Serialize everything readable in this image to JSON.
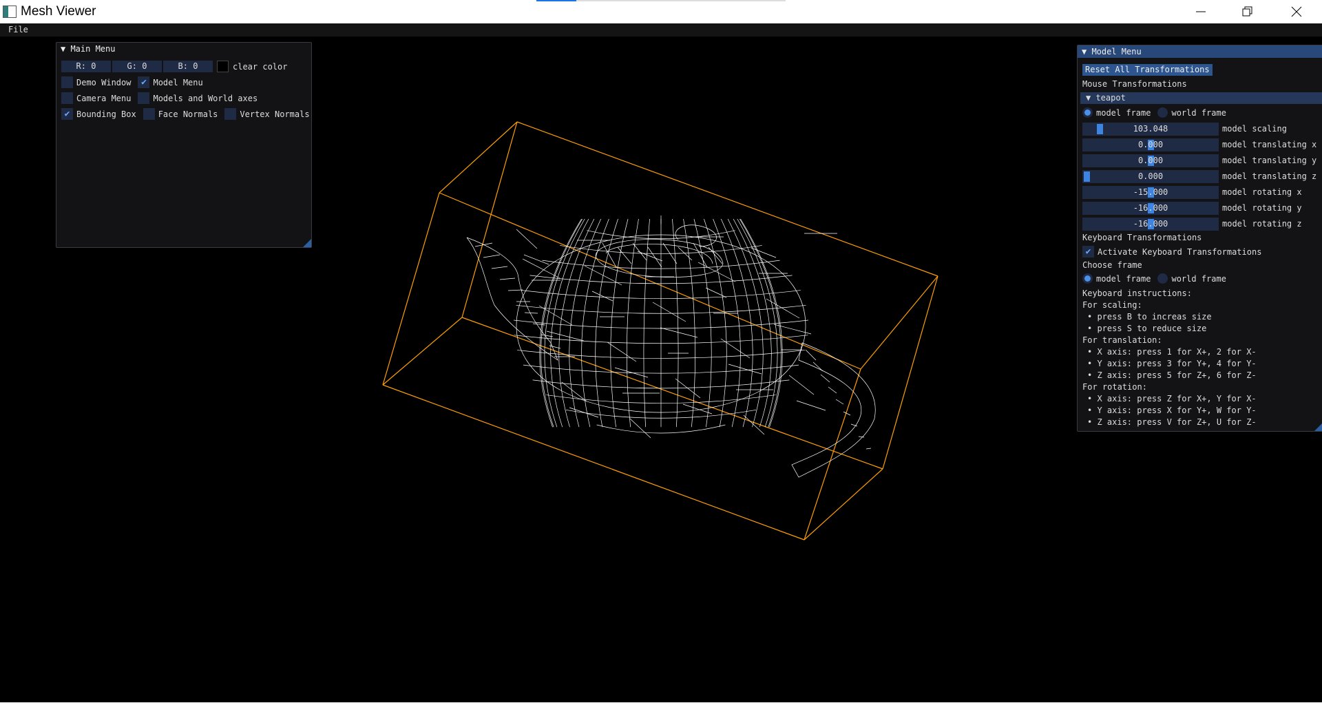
{
  "window": {
    "title": "Mesh Viewer",
    "progress": 0.16,
    "minimize_icon": "minimize-icon",
    "restore_icon": "restore-icon",
    "close_icon": "close-icon"
  },
  "menubar": {
    "file": "File"
  },
  "main_menu": {
    "title": "Main Menu",
    "color_fields": [
      "R:  0",
      "G:  0",
      "B:  0"
    ],
    "clear_color_label": "clear color",
    "checkboxes": [
      {
        "label": "Demo Window",
        "checked": false
      },
      {
        "label": "Model Menu",
        "checked": true
      },
      {
        "label": "Camera Menu",
        "checked": false
      },
      {
        "label": "Models and World axes",
        "checked": false
      },
      {
        "label": "Bounding Box",
        "checked": true
      },
      {
        "label": "Face Normals",
        "checked": false
      },
      {
        "label": "Vertex Normals",
        "checked": false
      }
    ]
  },
  "model_menu": {
    "title": "Model Menu",
    "reset_button": "Reset All Transformations",
    "mouse_heading": "Mouse Transformations",
    "model_name": "teapot",
    "frame_model": "model frame",
    "frame_world": "world frame",
    "sliders": [
      {
        "value": "103.048",
        "label": "model scaling",
        "pos": 0.1
      },
      {
        "value": "0.000",
        "label": "model translating x",
        "pos": 0.5
      },
      {
        "value": "0.000",
        "label": "model translating y",
        "pos": 0.5
      },
      {
        "value": "0.000",
        "label": "model translating z",
        "pos": 0.0
      },
      {
        "value": "-15.000",
        "label": "model rotating x",
        "pos": 0.5
      },
      {
        "value": "-16.000",
        "label": "model rotating y",
        "pos": 0.5
      },
      {
        "value": "-16.000",
        "label": "model rotating z",
        "pos": 0.5
      }
    ],
    "keyboard_heading": "Keyboard Transformations",
    "activate_keyboard": "Activate Keyboard Transformations",
    "choose_frame": "Choose frame",
    "instructions_heading": "Keyboard instructions:",
    "scaling_heading": "For scaling:",
    "scaling_items": [
      "press B to increas size",
      "press S to reduce size"
    ],
    "translation_heading": "For translation:",
    "translation_items": [
      "X axis: press 1 for X+, 2 for X-",
      "Y axis: press 3 for Y+, 4 for Y-",
      "Z axis: press 5 for Z+, 6 for Z-"
    ],
    "rotation_heading": "For rotation:",
    "rotation_items": [
      "X axis: press Z for X+, Y for X-",
      "Y axis: press X for Y+, W for Y-",
      "Z axis: press V for Z+, U for Z-"
    ]
  },
  "scene": {
    "bbox_color": "#ffa000",
    "mesh_color": "#ffffff"
  }
}
